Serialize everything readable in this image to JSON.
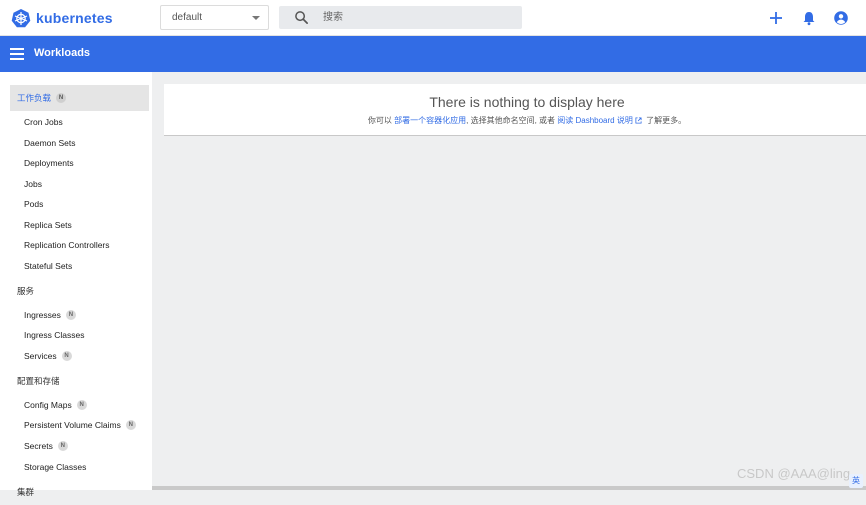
{
  "brand": {
    "name": "kubernetes",
    "color": "#326ce5"
  },
  "namespace": {
    "selected": "default"
  },
  "search": {
    "placeholder": "搜索"
  },
  "appbar": {
    "title": "Workloads",
    "color": "#326ce5"
  },
  "sidebar": {
    "sections": [
      {
        "label": "工作负载",
        "badge": "N",
        "active": true
      },
      {
        "label": "服务"
      },
      {
        "label": "配置和存储"
      },
      {
        "label": "集群"
      }
    ],
    "workloads": [
      "Cron Jobs",
      "Daemon Sets",
      "Deployments",
      "Jobs",
      "Pods",
      "Replica Sets",
      "Replication Controllers",
      "Stateful Sets"
    ],
    "services": [
      {
        "label": "Ingresses",
        "badge": "N"
      },
      {
        "label": "Ingress Classes"
      },
      {
        "label": "Services",
        "badge": "N"
      }
    ],
    "config": [
      {
        "label": "Config Maps",
        "badge": "N"
      },
      {
        "label": "Persistent Volume Claims",
        "badge": "N"
      },
      {
        "label": "Secrets",
        "badge": "N"
      },
      {
        "label": "Storage Classes"
      }
    ]
  },
  "empty": {
    "title": "There is nothing to display here",
    "t1": "你可以 ",
    "link1": "部署一个容器化应用",
    "t2": ", 选择其他命名空间, 或者 ",
    "link2": "阅读 Dashboard 说明",
    "t3": " 了解更多。"
  },
  "watermark": "CSDN @AAA@ling",
  "corner": "英"
}
